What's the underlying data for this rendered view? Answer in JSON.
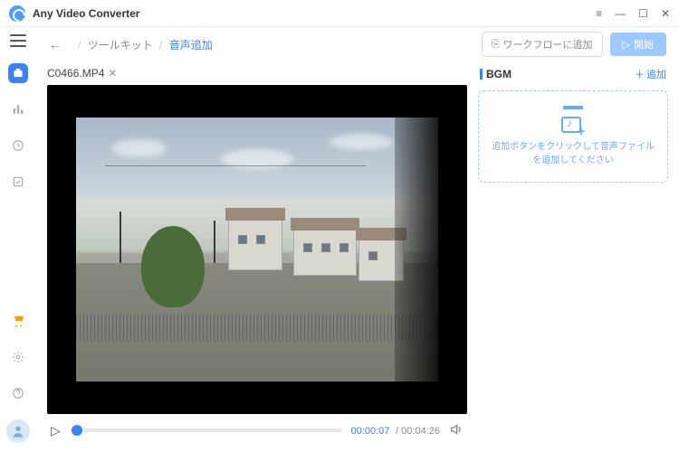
{
  "app": {
    "title": "Any Video Converter"
  },
  "breadcrumb": {
    "parent": "ツールキット",
    "current": "音声追加"
  },
  "topbar": {
    "workflow_label": "ワークフローに追加",
    "start_label": "開始"
  },
  "video": {
    "filename": "C0466.MP4",
    "current_time": "00:00:07",
    "total_time": "00:04:26"
  },
  "bgm": {
    "title": "BGM",
    "add_label": "追加",
    "dropzone_text": "追加ボタンをクリックして音声ファイルを追加してください"
  }
}
